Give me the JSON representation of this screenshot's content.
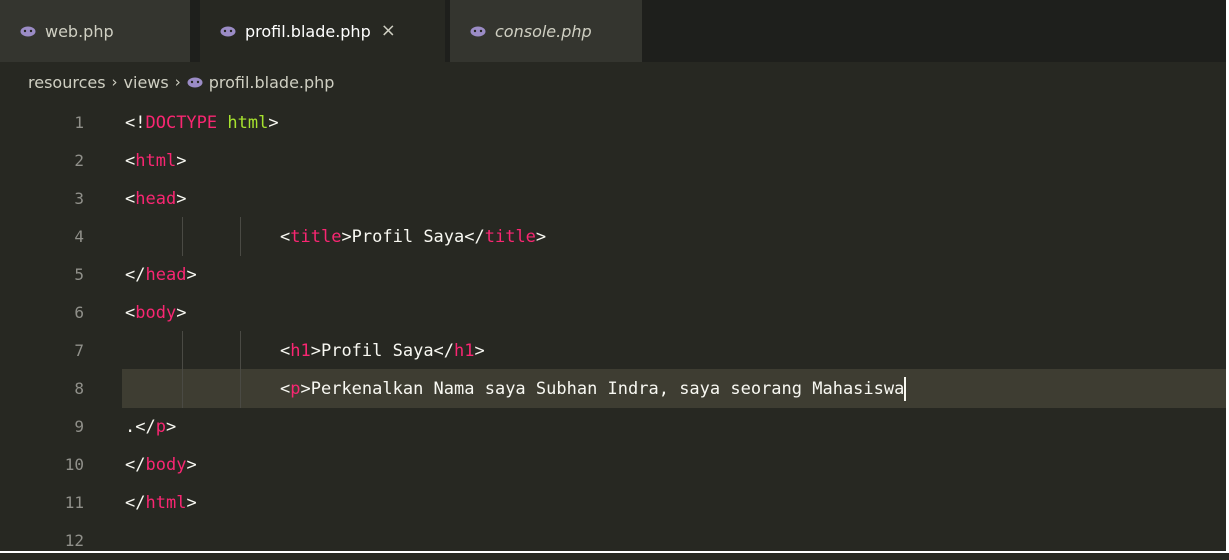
{
  "tabs": [
    {
      "label": "web.php",
      "icon": "php-elephant-icon",
      "active": false,
      "italic": false
    },
    {
      "label": "profil.blade.php",
      "icon": "php-elephant-icon",
      "active": true,
      "italic": false,
      "close": "×"
    },
    {
      "label": "console.php",
      "icon": "php-elephant-icon",
      "active": false,
      "italic": true
    }
  ],
  "breadcrumb": {
    "parts": [
      "resources",
      "views",
      "profil.blade.php"
    ],
    "separator": "›"
  },
  "editor": {
    "current_line": 8,
    "lines": [
      {
        "num": "1",
        "tokens": [
          {
            "t": "<!",
            "c": "txt"
          },
          {
            "t": "DOCTYPE",
            "c": "kw-tag"
          },
          {
            "t": " ",
            "c": "txt"
          },
          {
            "t": "html",
            "c": "kw-green"
          },
          {
            "t": ">",
            "c": "txt"
          }
        ],
        "indent": 0
      },
      {
        "num": "2",
        "tokens": [
          {
            "t": "<",
            "c": "txt"
          },
          {
            "t": "html",
            "c": "kw-tag"
          },
          {
            "t": ">",
            "c": "txt"
          }
        ],
        "indent": 0
      },
      {
        "num": "3",
        "tokens": [
          {
            "t": "<",
            "c": "txt"
          },
          {
            "t": "head",
            "c": "kw-tag"
          },
          {
            "t": ">",
            "c": "txt"
          }
        ],
        "indent": 0
      },
      {
        "num": "4",
        "tokens": [
          {
            "t": "<",
            "c": "txt"
          },
          {
            "t": "title",
            "c": "kw-tag"
          },
          {
            "t": ">Profil Saya</",
            "c": "txt"
          },
          {
            "t": "title",
            "c": "kw-tag"
          },
          {
            "t": ">",
            "c": "txt"
          }
        ],
        "indent": 1
      },
      {
        "num": "5",
        "tokens": [
          {
            "t": "</",
            "c": "txt"
          },
          {
            "t": "head",
            "c": "kw-tag"
          },
          {
            "t": ">",
            "c": "txt"
          }
        ],
        "indent": 0
      },
      {
        "num": "6",
        "tokens": [
          {
            "t": "<",
            "c": "txt"
          },
          {
            "t": "body",
            "c": "kw-tag"
          },
          {
            "t": ">",
            "c": "txt"
          }
        ],
        "indent": 0
      },
      {
        "num": "7",
        "tokens": [
          {
            "t": "<",
            "c": "txt"
          },
          {
            "t": "h1",
            "c": "kw-tag"
          },
          {
            "t": ">Profil Saya</",
            "c": "txt"
          },
          {
            "t": "h1",
            "c": "kw-tag"
          },
          {
            "t": ">",
            "c": "txt"
          }
        ],
        "indent": 1
      },
      {
        "num": "8",
        "tokens": [
          {
            "t": "<",
            "c": "txt"
          },
          {
            "t": "p",
            "c": "kw-tag"
          },
          {
            "t": ">Perkenalkan Nama saya Subhan Indra, saya seorang Mahasiswa",
            "c": "txt"
          }
        ],
        "indent": 1,
        "cursor": true
      },
      {
        "num": "9",
        "tokens": [
          {
            "t": ".</",
            "c": "txt"
          },
          {
            "t": "p",
            "c": "kw-tag"
          },
          {
            "t": ">",
            "c": "txt"
          }
        ],
        "indent": 0
      },
      {
        "num": "10",
        "tokens": [
          {
            "t": "</",
            "c": "txt"
          },
          {
            "t": "body",
            "c": "kw-tag"
          },
          {
            "t": ">",
            "c": "txt"
          }
        ],
        "indent": 0
      },
      {
        "num": "11",
        "tokens": [
          {
            "t": "</",
            "c": "txt"
          },
          {
            "t": "html",
            "c": "kw-tag"
          },
          {
            "t": ">",
            "c": "txt"
          }
        ],
        "indent": 0
      },
      {
        "num": "12",
        "tokens": [],
        "indent": 0
      }
    ]
  },
  "colors": {
    "background": "#272822",
    "tag": "#f92672",
    "attribute": "#a6e22e",
    "text": "#f8f8f2",
    "line_number": "#90908a",
    "current_line": "#3e3d32"
  }
}
